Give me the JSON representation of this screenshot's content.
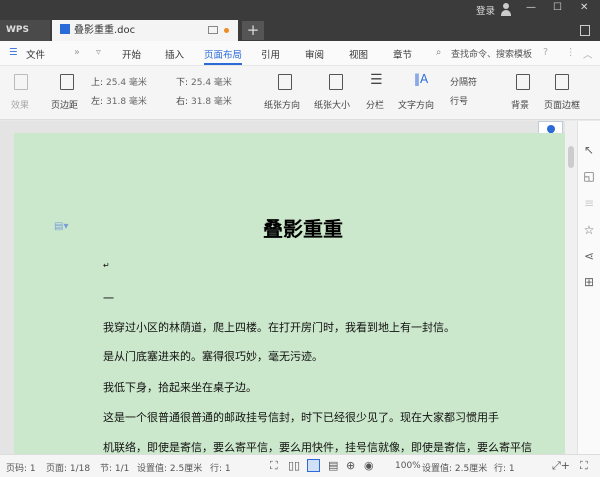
{
  "titlebar": {
    "login": "登录",
    "minimize": "—",
    "maximize": "☐",
    "close": "✕"
  },
  "tabs": {
    "app": "WPS",
    "doc_title": "叠影重重.doc",
    "new_tab": "+"
  },
  "menu": {
    "file": "文件",
    "items": [
      "开始",
      "插入",
      "页面布局",
      "引用",
      "审阅",
      "视图",
      "章节"
    ],
    "active": "页面布局",
    "search_placeholder": "查找命令、搜索模板",
    "help": "?"
  },
  "ribbon": {
    "effects": "效果",
    "margins": "页边距",
    "top_label": "上:",
    "top_value": "25.4 毫米",
    "bottom_label": "下:",
    "bottom_value": "25.4 毫米",
    "left_label": "左:",
    "left_value": "31.8 毫米",
    "right_label": "右:",
    "right_value": "31.8 毫米",
    "orientation": "纸张方向",
    "size": "纸张大小",
    "columns": "分栏",
    "text_direction": "文字方向",
    "separator": "分隔符",
    "line_numbers": "行号",
    "background": "背景",
    "page_border": "页面边框"
  },
  "document": {
    "title": "叠影重重",
    "mark": "↵",
    "section": "一",
    "paragraphs": [
      "我穿过小区的林荫道，爬上四楼。在打开房门时，我看到地上有一封信。",
      "是从门底塞进来的。塞得很巧妙，毫无污迹。",
      "我低下身，拾起来坐在桌子边。",
      "这是一个很普通很普通的邮政挂号信封，时下已经很少见了。现在大家都习惯用手",
      "机联络，即使是寄信，要么寄平信，要么用快件，挂号信就像，即使是寄信，要么寄平信"
    ]
  },
  "status": {
    "page": "页码: 1",
    "pages": "页面: 1/18",
    "section": "节: 1/1",
    "setting": "设置值: 2.5厘米",
    "line": "行: 1",
    "zoom": "100%",
    "setting2": "设置值: 2.5厘米",
    "line2": "行: 1"
  }
}
